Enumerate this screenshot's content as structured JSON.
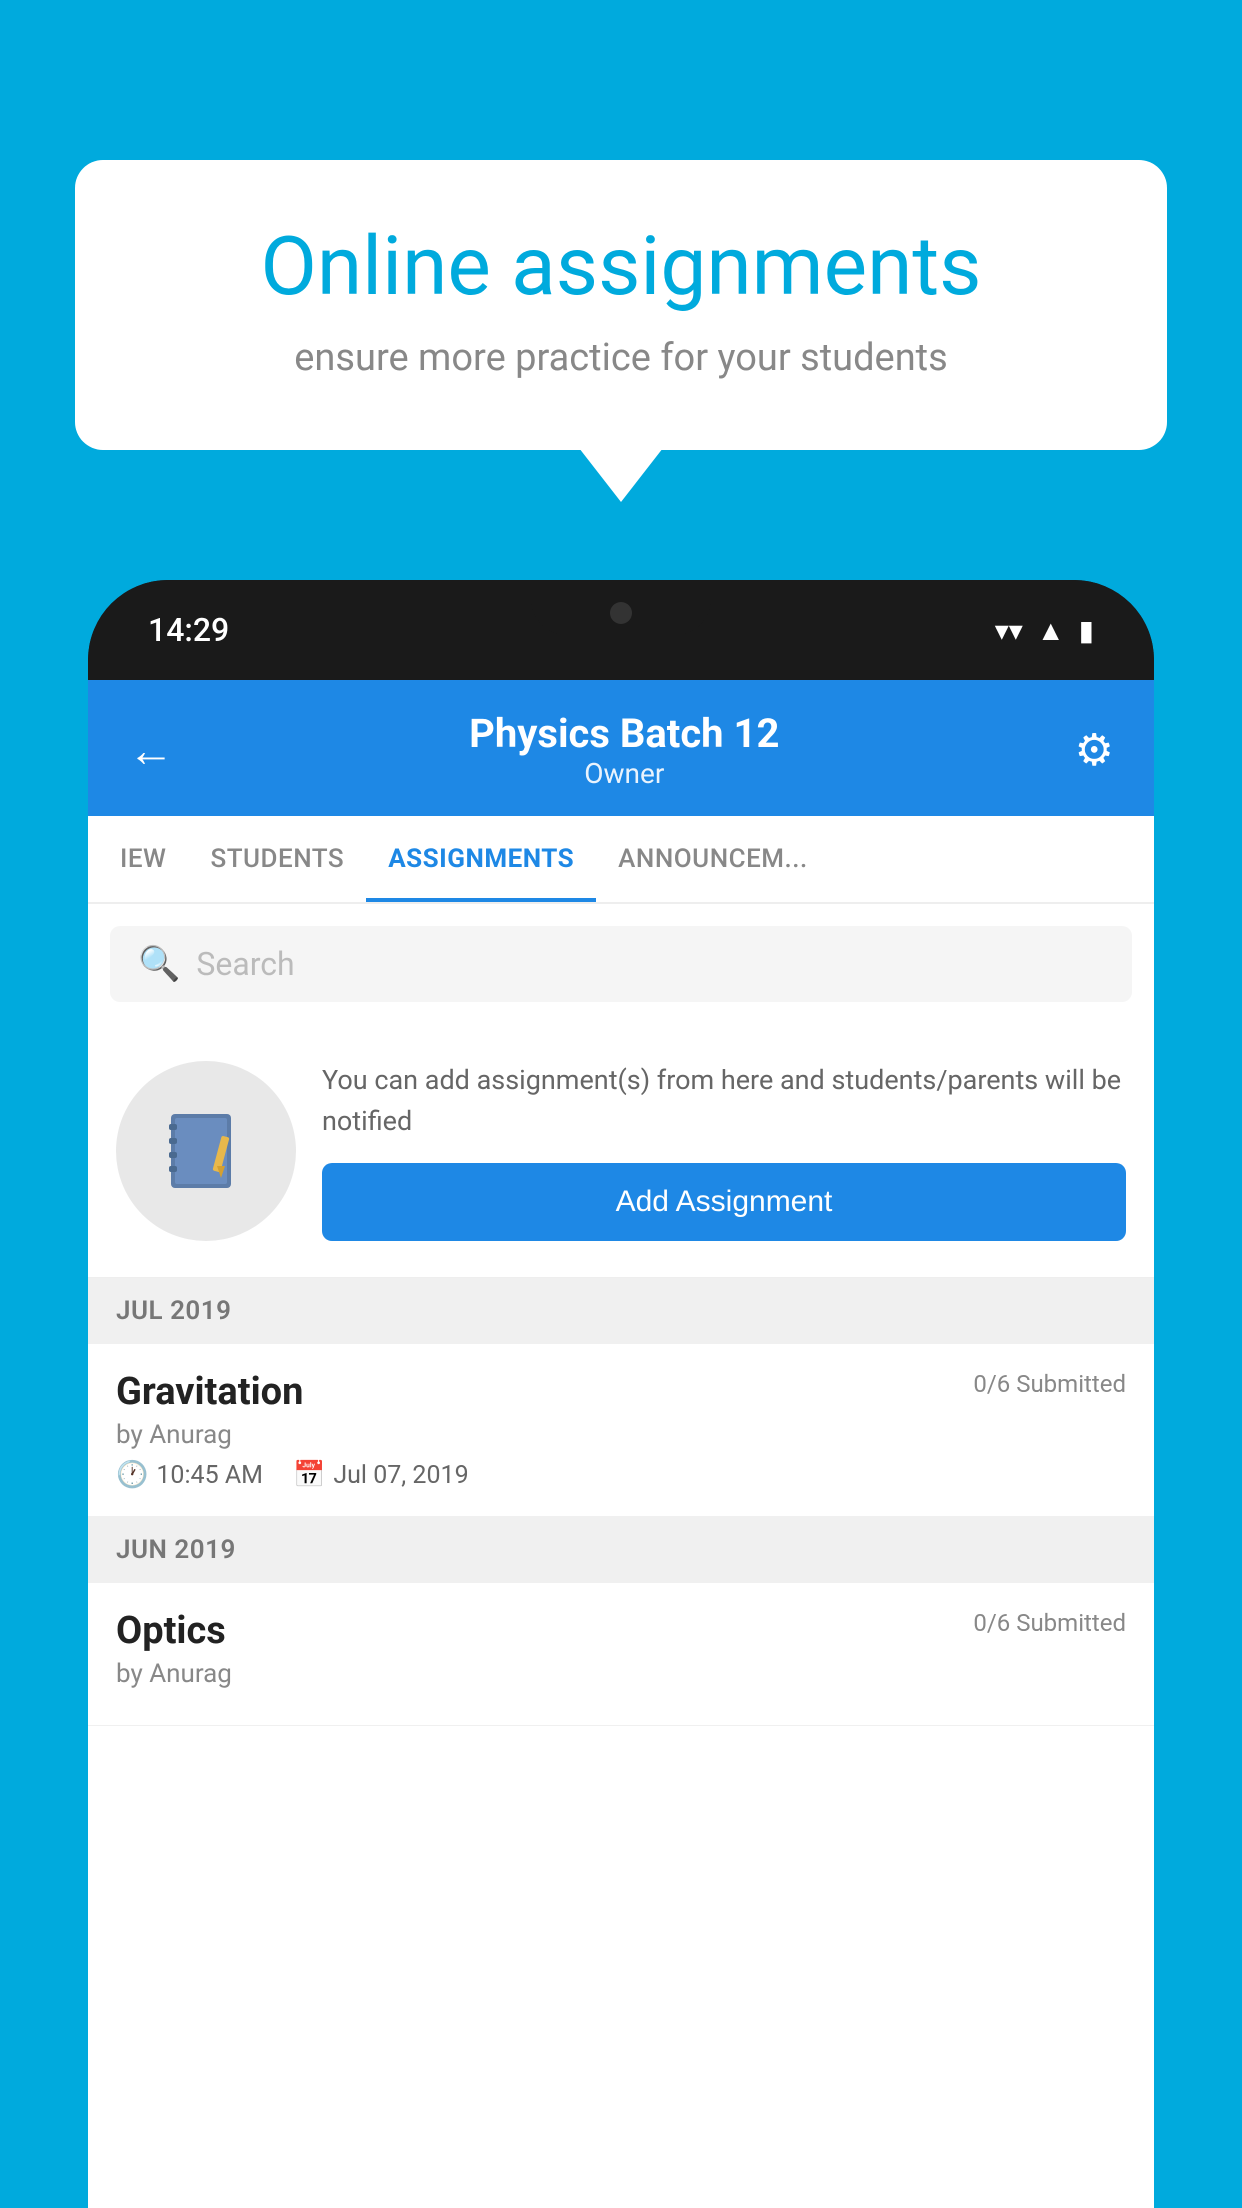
{
  "background_color": "#00AADD",
  "speech_bubble": {
    "title": "Online assignments",
    "subtitle": "ensure more practice for your students"
  },
  "phone": {
    "status_bar": {
      "time": "14:29",
      "icons": [
        "wifi",
        "signal",
        "battery"
      ]
    },
    "header": {
      "title": "Physics Batch 12",
      "subtitle": "Owner",
      "back_label": "←",
      "settings_label": "⚙"
    },
    "tabs": [
      {
        "label": "IEW",
        "active": false
      },
      {
        "label": "STUDENTS",
        "active": false
      },
      {
        "label": "ASSIGNMENTS",
        "active": true
      },
      {
        "label": "ANNOUNCEM...",
        "active": false
      }
    ],
    "search": {
      "placeholder": "Search"
    },
    "promo": {
      "description": "You can add assignment(s) from here and students/parents will be notified",
      "button_label": "Add Assignment"
    },
    "assignment_sections": [
      {
        "month": "JUL 2019",
        "assignments": [
          {
            "name": "Gravitation",
            "submitted": "0/6 Submitted",
            "by": "by Anurag",
            "time": "10:45 AM",
            "date": "Jul 07, 2019"
          }
        ]
      },
      {
        "month": "JUN 2019",
        "assignments": [
          {
            "name": "Optics",
            "submitted": "0/6 Submitted",
            "by": "by Anurag",
            "time": "",
            "date": ""
          }
        ]
      }
    ]
  }
}
